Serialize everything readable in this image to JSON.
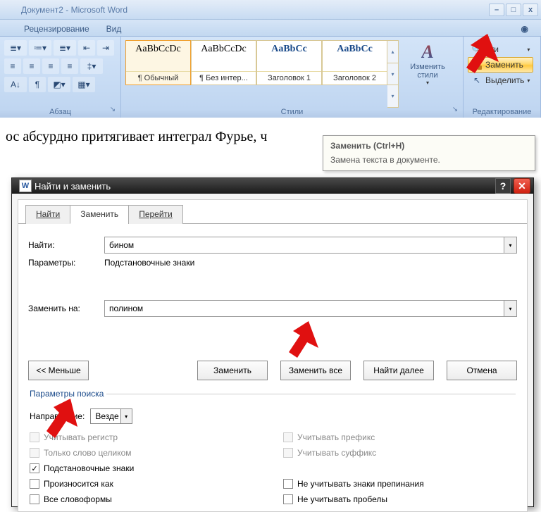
{
  "window": {
    "title": "Документ2 - Microsoft Word"
  },
  "top_tabs": {
    "review": "Рецензирование",
    "view": "Вид"
  },
  "ribbon": {
    "paragraph_label": "Абзац",
    "styles_label": "Стили",
    "editing_label": "Редактирование",
    "styles": {
      "sample": "AaBbCcDc",
      "sample_heading": "AaBbCc",
      "normal": "¶ Обычный",
      "no_spacing": "¶ Без интер...",
      "heading1": "Заголовок 1",
      "heading2": "Заголовок 2"
    },
    "change_styles": "Изменить стили",
    "editing": {
      "find": "йти",
      "replace": "Заменить",
      "select": "Выделить"
    }
  },
  "tooltip": {
    "title": "Заменить (Ctrl+H)",
    "desc": "Замена текста в документе."
  },
  "document": {
    "line": "ос абсурдно притягивает интеграл Фурье, ч"
  },
  "dialog": {
    "title": "Найти и заменить",
    "tabs": {
      "find": "Найти",
      "replace": "Заменить",
      "goto": "Перейти"
    },
    "find_label": "Найти:",
    "find_value": "бином",
    "params_label": "Параметры:",
    "params_value": "Подстановочные знаки",
    "replace_label": "Заменить на:",
    "replace_value": "полином",
    "btn_less": "<< Меньше",
    "btn_replace": "Заменить",
    "btn_replace_all": "Заменить все",
    "btn_next": "Найти далее",
    "btn_cancel": "Отмена",
    "search_legend": "Параметры поиска",
    "direction_label": "Направление:",
    "direction_value": "Везде",
    "opts": {
      "match_case": "Учитывать регистр",
      "whole_word": "Только слово целиком",
      "wildcards": "Подстановочные знаки",
      "sounds_like": "Произносится как",
      "all_forms": "Все словоформы",
      "prefix": "Учитывать префикс",
      "suffix": "Учитывать суффикс",
      "ignore_punct": "Не учитывать знаки препинания",
      "ignore_space": "Не учитывать пробелы"
    }
  }
}
